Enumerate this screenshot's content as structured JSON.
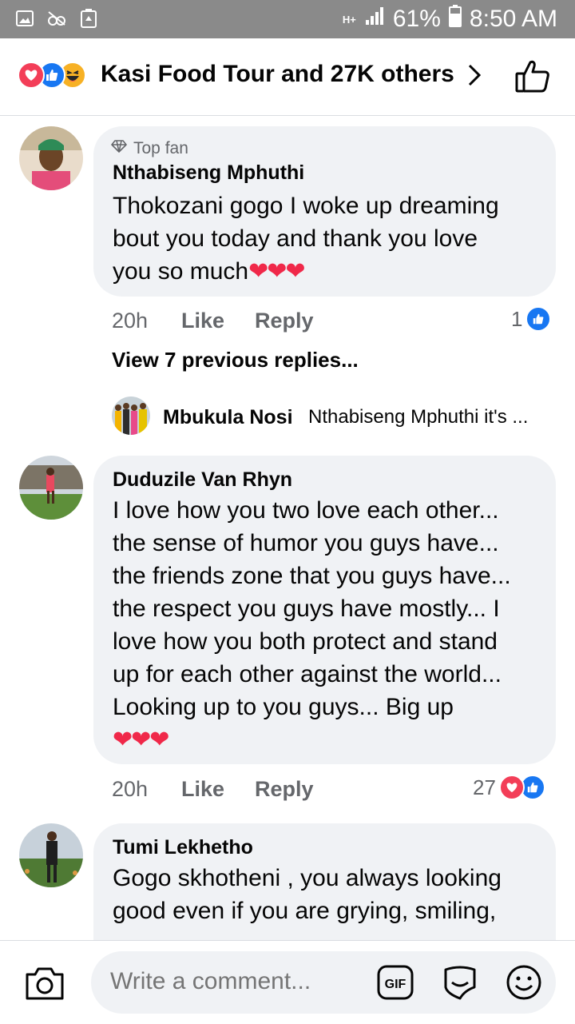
{
  "status_bar": {
    "battery": "61%",
    "time": "8:50 AM",
    "network": "H+"
  },
  "header": {
    "reaction_icons": [
      "love-icon",
      "like-icon",
      "haha-icon"
    ],
    "title": "Kasi Food Tour and 27K others"
  },
  "comments": [
    {
      "badge": "Top fan",
      "name": "Nthabiseng Mphuthi",
      "lines": [
        "Thokozani gogo I woke up dreaming",
        "bout you today and thank you love",
        "you so much"
      ],
      "trailing_emoji": "❤❤❤",
      "time": "20h",
      "like_label": "Like",
      "reply_label": "Reply",
      "reaction_count": "1"
    },
    {
      "name": "Duduzile Van Rhyn",
      "lines": [
        "I love how you two love each other...",
        "the sense of humor you guys have...",
        "the friends zone that you guys have...",
        "the respect you guys have mostly... I",
        "love how you both protect and stand",
        "up for each other against the world...",
        "Looking up to you guys... Big up"
      ],
      "trailing_emoji": "❤❤❤",
      "time": "20h",
      "like_label": "Like",
      "reply_label": "Reply",
      "reaction_count": "27"
    },
    {
      "name": "Tumi Lekhetho",
      "lines": [
        "Gogo skhotheni , you always looking",
        "good even if you are grying, smiling,"
      ]
    }
  ],
  "view_previous": "View 7 previous replies...",
  "reply_preview": {
    "name": "Mbukula Nosi",
    "text": "Nthabiseng Mphuthi it's ..."
  },
  "composer": {
    "placeholder": "Write a comment..."
  },
  "colors": {
    "love": "#f33e58",
    "like": "#1877f2",
    "haha": "#f7b125",
    "bubble": "#f0f2f5",
    "secondary_text": "#65676b"
  }
}
